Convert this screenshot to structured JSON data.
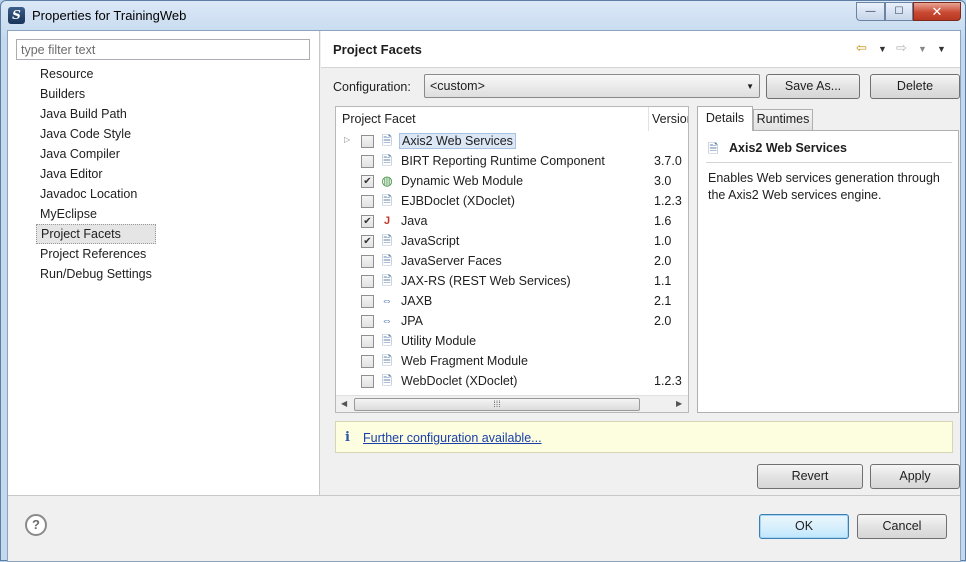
{
  "window": {
    "title": "Properties for TrainingWeb",
    "controls": {
      "minimize": "—",
      "maximize": "☐",
      "close": "✕"
    }
  },
  "sidebar": {
    "filter_placeholder": "type filter text",
    "items": [
      {
        "label": "Resource"
      },
      {
        "label": "Builders"
      },
      {
        "label": "Java Build Path"
      },
      {
        "label": "Java Code Style"
      },
      {
        "label": "Java Compiler"
      },
      {
        "label": "Java Editor"
      },
      {
        "label": "Javadoc Location"
      },
      {
        "label": "MyEclipse"
      },
      {
        "label": "Project Facets",
        "selected": true
      },
      {
        "label": "Project References"
      },
      {
        "label": "Run/Debug Settings"
      }
    ]
  },
  "page": {
    "title": "Project Facets",
    "header_icons": [
      "back-arrow-icon",
      "forward-arrow-icon",
      "view-menu-icon"
    ]
  },
  "configuration": {
    "label": "Configuration:",
    "selected": "<custom>",
    "save_as_label": "Save As...",
    "delete_label": "Delete"
  },
  "facets": {
    "columns": [
      "Project Facet",
      "Version"
    ],
    "rows": [
      {
        "name": "Axis2 Web Services",
        "version": "",
        "checked": false,
        "icon": "doc-icon",
        "selected": true,
        "expandable": true
      },
      {
        "name": "BIRT Reporting Runtime Component",
        "version": "3.7.0",
        "checked": false,
        "icon": "doc-icon"
      },
      {
        "name": "Dynamic Web Module",
        "version": "3.0",
        "checked": true,
        "icon": "globe-icon"
      },
      {
        "name": "EJBDoclet (XDoclet)",
        "version": "1.2.3",
        "checked": false,
        "icon": "doc-icon"
      },
      {
        "name": "Java",
        "version": "1.6",
        "checked": true,
        "icon": "java-icon"
      },
      {
        "name": "JavaScript",
        "version": "1.0",
        "checked": true,
        "icon": "doc-icon"
      },
      {
        "name": "JavaServer Faces",
        "version": "2.0",
        "checked": false,
        "icon": "doc-icon"
      },
      {
        "name": "JAX-RS (REST Web Services)",
        "version": "1.1",
        "checked": false,
        "icon": "doc-icon"
      },
      {
        "name": "JAXB",
        "version": "2.1",
        "checked": false,
        "icon": "arrows-icon"
      },
      {
        "name": "JPA",
        "version": "2.0",
        "checked": false,
        "icon": "arrows-icon"
      },
      {
        "name": "Utility Module",
        "version": "",
        "checked": false,
        "icon": "doc-icon"
      },
      {
        "name": "Web Fragment Module",
        "version": "",
        "checked": false,
        "icon": "doc-icon"
      },
      {
        "name": "WebDoclet (XDoclet)",
        "version": "1.2.3",
        "checked": false,
        "icon": "doc-icon"
      }
    ]
  },
  "details": {
    "tabs": [
      "Details",
      "Runtimes"
    ],
    "active_tab": "Details",
    "title": "Axis2 Web Services",
    "description": "Enables Web services generation through the Axis2 Web services engine."
  },
  "info_bar": {
    "icon": "i",
    "link": "Further configuration available..."
  },
  "actions": {
    "revert": "Revert",
    "apply": "Apply",
    "ok": "OK",
    "cancel": "Cancel"
  },
  "help_icon": "?"
}
